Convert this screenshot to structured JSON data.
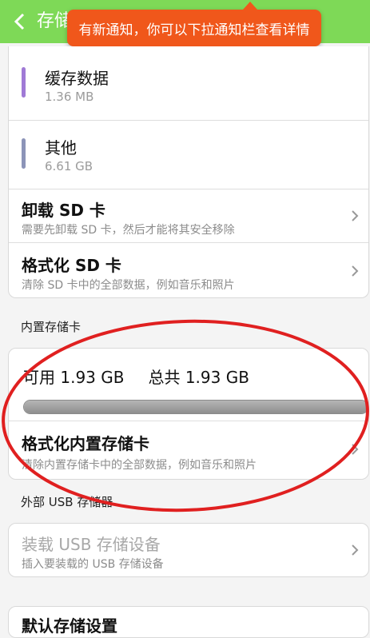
{
  "header": {
    "title": "存储"
  },
  "toast": {
    "text": "有新通知，你可以下拉通知栏查看详情"
  },
  "categories": [
    {
      "label": "缓存数据",
      "size": "1.36 MB",
      "color": "#a07ad6"
    },
    {
      "label": "其他",
      "size": "6.61 GB",
      "color": "#8c94b8"
    }
  ],
  "sd_actions": [
    {
      "title": "卸载 SD 卡",
      "subtitle": "需要先卸载 SD 卡，然后才能将其安全移除"
    },
    {
      "title": "格式化 SD 卡",
      "subtitle": "清除 SD 卡中的全部数据，例如音乐和照片"
    }
  ],
  "internal": {
    "section_label": "内置存储卡",
    "available": "可用 1.93 GB",
    "total": "总共 1.93 GB",
    "used_fraction": 1.0,
    "format_title": "格式化内置存储卡",
    "format_subtitle": "清除内置存储卡中的全部数据，例如音乐和照片"
  },
  "usb": {
    "section_label": "外部 USB 存储器",
    "mount_title": "装载 USB 存储设备",
    "mount_subtitle": "插入要装载的 USB 存储设备"
  },
  "default_storage": {
    "title": "默认存储设置"
  },
  "colors": {
    "header": "#7ed957",
    "toast": "#f0571b",
    "annotation": "#e02020"
  }
}
